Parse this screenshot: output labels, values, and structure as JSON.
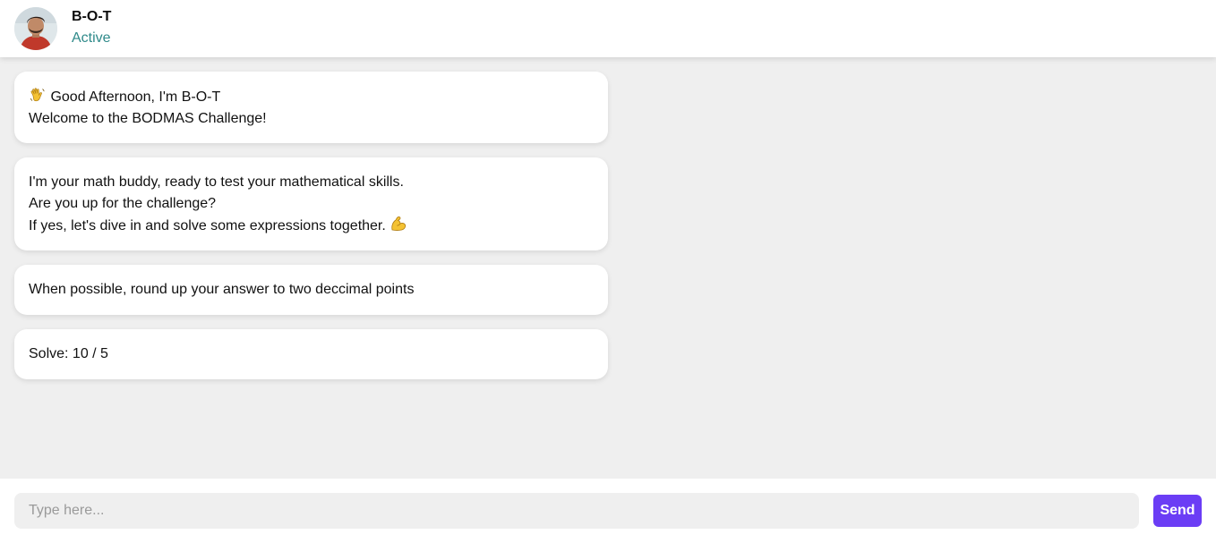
{
  "header": {
    "bot_name": "B-O-T",
    "status": "Active",
    "avatar_icon": "user-avatar-icon"
  },
  "messages": [
    {
      "emoji_icon": "waving-hand-icon",
      "lines": [
        "Good Afternoon, I'm B-O-T",
        "Welcome to the BODMAS Challenge!"
      ]
    },
    {
      "emoji_icon": "flexed-biceps-icon",
      "lines": [
        "I'm your math buddy, ready to test your mathematical skills.",
        "Are you up for the challenge?",
        "If yes, let's dive in and solve some expressions together."
      ]
    },
    {
      "lines": [
        "When possible, round up your answer to two deccimal points"
      ]
    },
    {
      "lines": [
        "Solve: 10 / 5"
      ]
    }
  ],
  "composer": {
    "placeholder": "Type here...",
    "value": "",
    "send_label": "Send"
  },
  "colors": {
    "accent": "#6b3df5",
    "status": "#2f8a8a",
    "background": "#efefef",
    "bubble": "#ffffff"
  }
}
